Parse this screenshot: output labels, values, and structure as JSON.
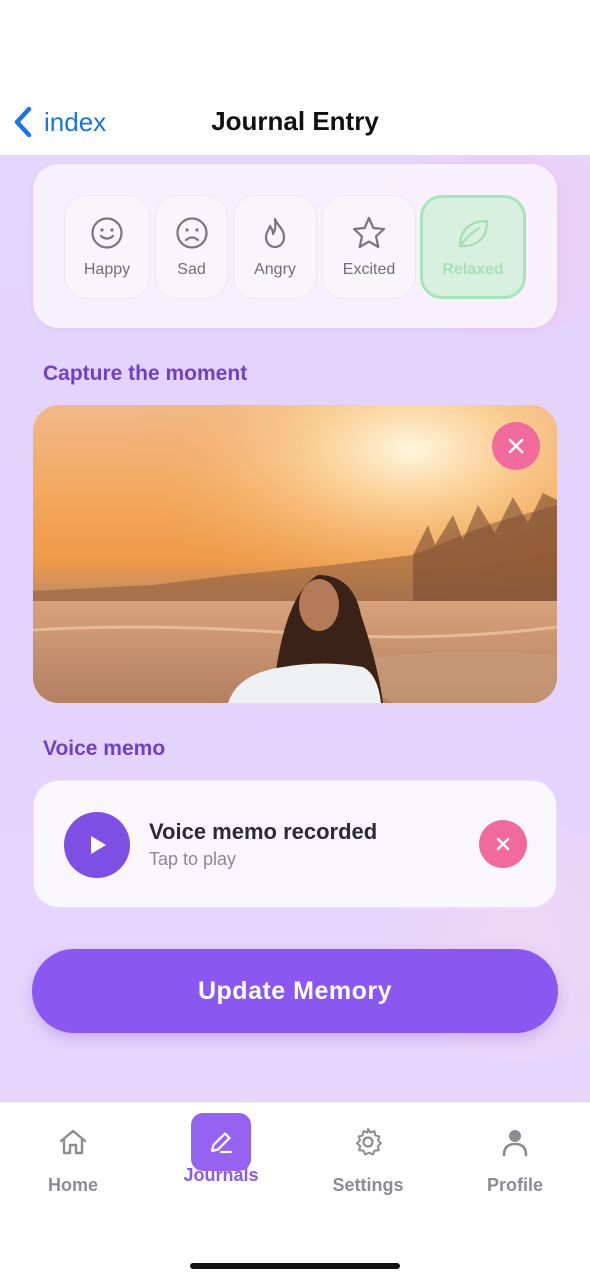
{
  "nav": {
    "back_label": "index",
    "title": "Journal Entry"
  },
  "moods": [
    {
      "label": "Happy",
      "icon": "smile-icon"
    },
    {
      "label": "Sad",
      "icon": "frown-icon"
    },
    {
      "label": "Angry",
      "icon": "flame-icon"
    },
    {
      "label": "Excited",
      "icon": "star-icon"
    },
    {
      "label": "Relaxed",
      "icon": "leaf-icon",
      "selected": true
    }
  ],
  "photo_section": {
    "label": "Capture the moment"
  },
  "voice_section": {
    "label": "Voice memo",
    "title": "Voice memo recorded",
    "subtitle": "Tap to play"
  },
  "actions": {
    "update_label": "Update Memory"
  },
  "tabs": [
    {
      "label": "Home",
      "icon": "home-icon"
    },
    {
      "label": "Journals",
      "icon": "pencil-icon",
      "active": true
    },
    {
      "label": "Settings",
      "icon": "gear-icon"
    },
    {
      "label": "Profile",
      "icon": "person-icon"
    }
  ],
  "colors": {
    "accent": "#8a57f0",
    "link": "#1a73e8",
    "remove": "#f06b9c",
    "selected_mood": "#a5e6b7"
  }
}
